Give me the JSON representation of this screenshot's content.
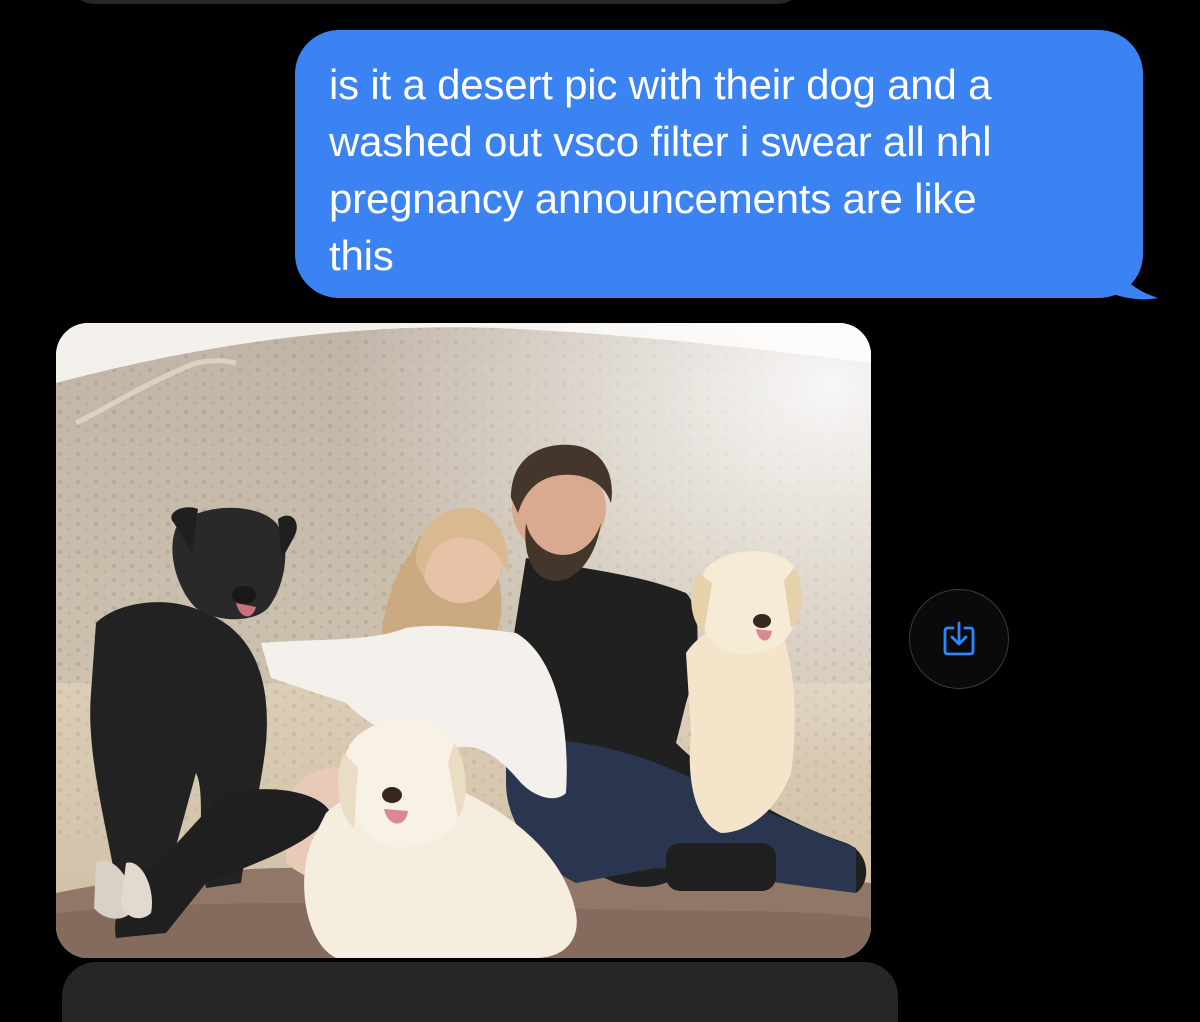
{
  "conversation": {
    "sent_message": {
      "text": "is it a desert pic with their dog and a\nwashed out vsco filter i swear all nhl\npregnancy announcements are like\nthis"
    },
    "received_photo": {
      "subject": "couple with three dogs on a blanket in the desert"
    },
    "save_action": {
      "icon": "save-to-device-icon"
    }
  },
  "colors": {
    "background": "#000000",
    "sent_bubble": "#3b82f2",
    "received_bubble": "#262628",
    "accent_icon": "#2d86ff"
  }
}
